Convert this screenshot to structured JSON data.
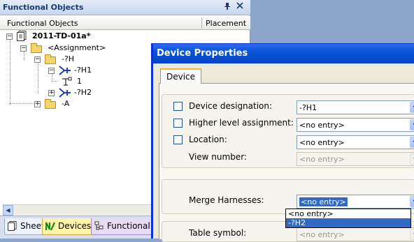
{
  "panel": {
    "title": "Functional Objects",
    "pin_label": "⌕",
    "close_label": "×",
    "columns": [
      "Functional Objects",
      "Placement"
    ]
  },
  "tree": {
    "root": "2011-TD-01a*",
    "assignment": "<Assignment>",
    "h_node": "-?H",
    "h1": "-?H1",
    "h1_child": "1",
    "h2": "-?H2",
    "a_node": "-A"
  },
  "bottom_tabs": [
    "Sheet",
    "Devices",
    "Functional Objects"
  ],
  "dialog": {
    "title": "Device Properties",
    "tab": "Device",
    "fields": {
      "device_designation": {
        "label": "Device designation:",
        "value": "-?H1"
      },
      "higher_level_assignment": {
        "label": "Higher level assignment:",
        "value": "<no entry>"
      },
      "location": {
        "label": "Location:",
        "value": "<no entry>"
      },
      "view_number": {
        "label": "View number:",
        "value": "<no entry>"
      },
      "merge_harnesses": {
        "label": "Merge Harnesses:",
        "value": "<no entry>"
      },
      "table_symbol": {
        "label": "Table symbol:",
        "value": "<no entry>"
      }
    },
    "dropdown_options": [
      "<no entry>",
      "-?H2"
    ]
  },
  "colors": {
    "dialog_title_bar": "#0a53d6",
    "selection": "#316ac5",
    "desktop": "#8ea6cc"
  }
}
